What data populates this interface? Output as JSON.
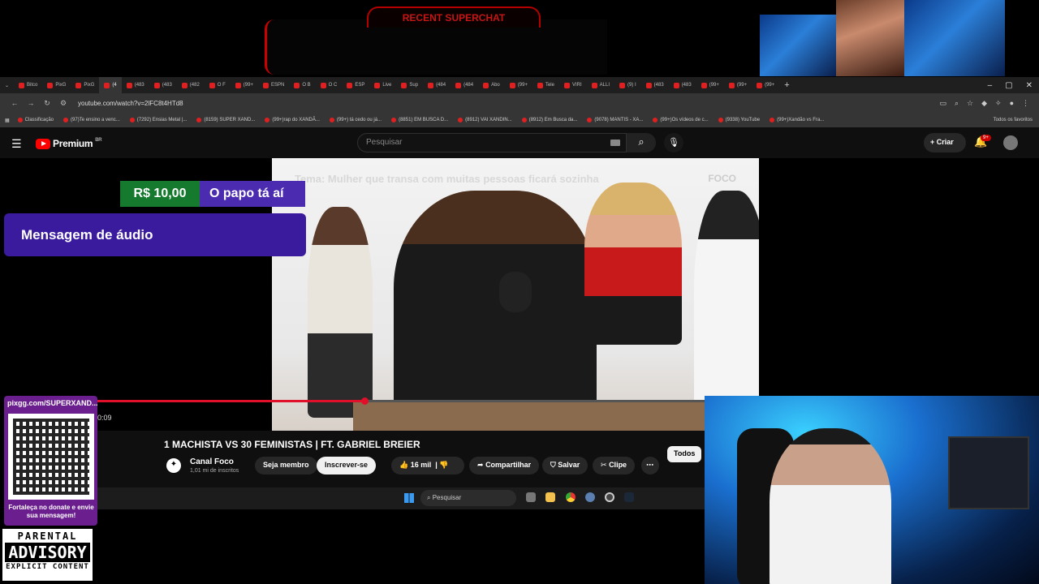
{
  "overlay": {
    "superchat_title": "RECENT SUPERCHAT",
    "alert_amount": "R$ 10,00",
    "alert_name": "O papo tá aí",
    "alert_message": "Mensagem de áudio",
    "qr_url": "pixgg.com/SUPERXAND...",
    "qr_note": "Fortaleça no donate e envie sua mensagem!",
    "advisory": [
      "PARENTAL",
      "ADVISORY",
      "EXPLICIT CONTENT"
    ]
  },
  "browser": {
    "tabs": [
      "Bitco",
      "PixG",
      "PixG",
      "(4",
      "(483",
      "(483",
      "(482",
      "O F",
      "(99+",
      "ESPN",
      "O B",
      "O C",
      "ESP",
      "Live",
      "Sup",
      "(484",
      "(484",
      "Abo",
      "(99+",
      "Tele",
      "VIRI",
      "ALLI",
      "(9) I",
      "(483",
      "(483",
      "(99+",
      "(99+",
      "(99+"
    ],
    "url": "youtube.com/watch?v=2lFC8t4HTd8",
    "bookmarks": [
      "Classificação",
      "(97)Te ensino a venc...",
      "(7292) Ensias Metal |...",
      "(8159) SUPER XAND...",
      "(99+)rap do XANDÃ...",
      "(99+) tá cedo ou já...",
      "(8851) EM BUSCA D...",
      "(8912) VAI XANDIN...",
      "(8912) Em Busca da...",
      "(9078) MANTIS - XA...",
      "(99+)Os vídeos de c...",
      "(9338) YouTube",
      "(99+)Xandão vs Fra..."
    ],
    "bookmarks_all": "Todos os favoritos"
  },
  "youtube": {
    "logo": "Premium",
    "region": "BR",
    "search_placeholder": "Pesquisar",
    "create": "Criar",
    "notif_count": "9+",
    "video_caption": "Tema: Mulher que transa com muitas pessoas ficará sozinha",
    "video_logo": "FOCO",
    "time": "0:09",
    "title": "1 MACHISTA VS 30 FEMINISTAS | FT. GABRIEL BREIER",
    "channel": "Canal Foco",
    "subs": "1,01 mi de inscritos",
    "member": "Seja membro",
    "subscribe": "Inscrever-se",
    "likes": "16 mil",
    "share": "Compartilhar",
    "save": "Salvar",
    "clip": "Clipe",
    "all": "Todos",
    "progress": 0.44
  },
  "taskbar": {
    "search": "Pesquisar"
  },
  "colors": {
    "accent": "#e0102a",
    "alert_green": "#167a2e",
    "alert_purple": "#4b2bb0"
  }
}
